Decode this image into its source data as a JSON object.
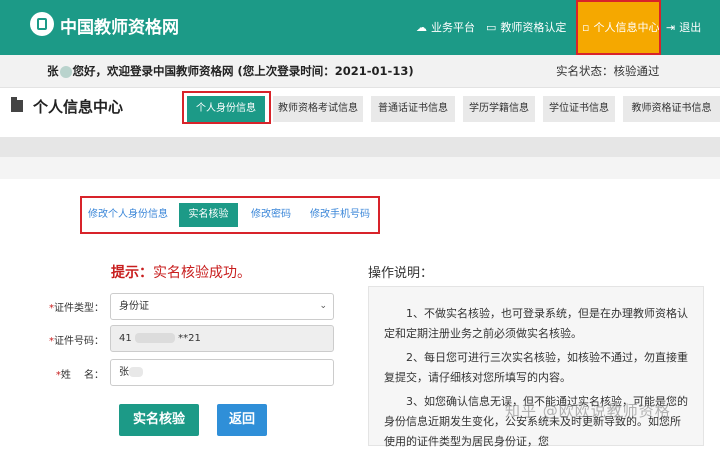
{
  "header": {
    "site_title": "中国教师资格网",
    "nav": {
      "business": "业务平台",
      "certification": "教师资格认定",
      "personal_center": "个人信息中心",
      "logout": "退出"
    }
  },
  "welcome": {
    "name": "张",
    "text": "您好，欢迎登录中国教师资格网 (您上次登录时间：2021-01-13)",
    "status": "实名状态：核验通过"
  },
  "page": {
    "title": "个人信息中心",
    "tabs": [
      "个人身份信息",
      "教师资格考试信息",
      "普通话证书信息",
      "学历学籍信息",
      "学位证书信息",
      "教师资格证书信息"
    ]
  },
  "subtabs": [
    "修改个人身份信息",
    "实名核验",
    "修改密码",
    "修改手机号码"
  ],
  "form": {
    "tip_prefix": "提示：",
    "tip_text": "实名核验成功。",
    "id_type_label": "证件类型：",
    "id_type_value": "身份证",
    "id_number_label": "证件号码：",
    "id_number_start": "41",
    "id_number_end": "**21",
    "name_label": "姓　 名：",
    "name_value": "张",
    "verify_button": "实名核验",
    "back_button": "返回"
  },
  "instructions": {
    "title": "操作说明：",
    "p1": "1、不做实名核验，也可登录系统，但是在办理教师资格认定和定期注册业务之前必须做实名核验。",
    "p2": "2、每日您可进行三次实名核验，如核验不通过，勿直接重复提交，请仔细核对您所填写的内容。",
    "p3": "3、如您确认信息无误，但不能通过实名核验，可能是您的身份信息近期发生变化，公安系统未及时更新导致的。如您所使用的证件类型为居民身份证，您"
  },
  "watermark": "知乎 @欧欧说教师资格",
  "colors": {
    "brand": "#1c9a87",
    "active_nav": "#f5a800",
    "highlight_box": "#d8232a",
    "tip_red": "#c81e1e",
    "back_button": "#2f8fd8"
  }
}
